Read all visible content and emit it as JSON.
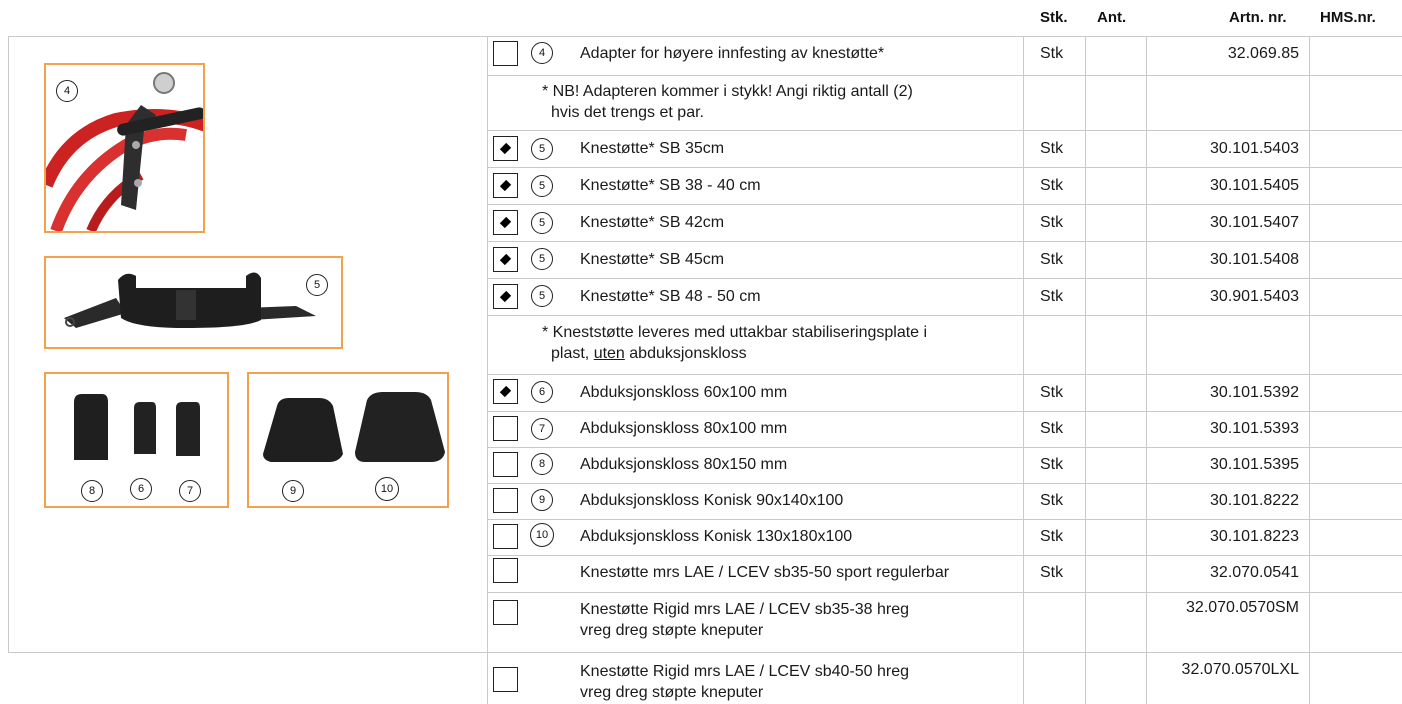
{
  "headers": {
    "stk": "Stk.",
    "ant": "Ant.",
    "artnr": "Artn. nr.",
    "hmsnr": "HMS.nr."
  },
  "images": {
    "knee_adapter": {
      "num": "4"
    },
    "knee_pad": {
      "num": "5"
    },
    "small_blocks": {
      "nums": [
        "8",
        "6",
        "7"
      ]
    },
    "conical_blocks": {
      "nums": [
        "9",
        "10"
      ]
    }
  },
  "rows": [
    {
      "check": "empty",
      "num": "4",
      "desc": "Adapter for høyere innfesting av knestøtte*",
      "stk": "Stk",
      "art": "32.069.85"
    },
    {
      "note_line1": "* NB! Adapteren kommer i stykk! Angi riktig antall (2)",
      "note_line2": "hvis det trengs et par."
    },
    {
      "check": "diamond",
      "num": "5",
      "desc": "Knestøtte* SB 35cm",
      "stk": "Stk",
      "art": "30.101.5403"
    },
    {
      "check": "diamond",
      "num": "5",
      "desc": "Knestøtte* SB 38 - 40 cm",
      "stk": "Stk",
      "art": "30.101.5405"
    },
    {
      "check": "diamond",
      "num": "5",
      "desc": "Knestøtte* SB 42cm",
      "stk": "Stk",
      "art": "30.101.5407"
    },
    {
      "check": "diamond",
      "num": "5",
      "desc": "Knestøtte* SB 45cm",
      "stk": "Stk",
      "art": "30.101.5408"
    },
    {
      "check": "diamond",
      "num": "5",
      "desc": "Knestøtte* SB 48 - 50 cm",
      "stk": "Stk",
      "art": "30.901.5403"
    },
    {
      "note_line1": "* Kneststøtte leveres med uttakbar stabiliseringsplate i",
      "note_line2_pre": "plast, ",
      "note_line2_u": "uten",
      "note_line2_post": " abduksjonskloss"
    },
    {
      "check": "diamond",
      "num": "6",
      "desc": "Abduksjonskloss 60x100 mm",
      "stk": "Stk",
      "art": "30.101.5392"
    },
    {
      "check": "empty",
      "num": "7",
      "desc": "Abduksjonskloss 80x100 mm",
      "stk": "Stk",
      "art": "30.101.5393"
    },
    {
      "check": "empty",
      "num": "8",
      "desc": "Abduksjonskloss 80x150 mm",
      "stk": "Stk",
      "art": "30.101.5395"
    },
    {
      "check": "empty",
      "num": "9",
      "desc": "Abduksjonskloss Konisk  90x140x100",
      "stk": "Stk",
      "art": "30.101.8222"
    },
    {
      "check": "empty",
      "num": "10",
      "desc": "Abduksjonskloss Konisk 130x180x100",
      "stk": "Stk",
      "art": "30.101.8223"
    },
    {
      "check": "empty",
      "desc": "Knestøtte mrs LAE / LCEV sb35-50 sport regulerbar",
      "stk": "Stk",
      "art": "32.070.0541"
    },
    {
      "check": "empty",
      "desc_line1": "Knestøtte Rigid mrs LAE / LCEV sb35-38 hreg",
      "desc_line2": "vreg dreg støpte kneputer",
      "art": "32.070.0570SM"
    },
    {
      "check": "empty",
      "desc_line1": "Knestøtte Rigid mrs LAE / LCEV sb40-50 hreg",
      "desc_line2": "vreg dreg støpte kneputer",
      "art": "32.070.0570LXL"
    }
  ]
}
